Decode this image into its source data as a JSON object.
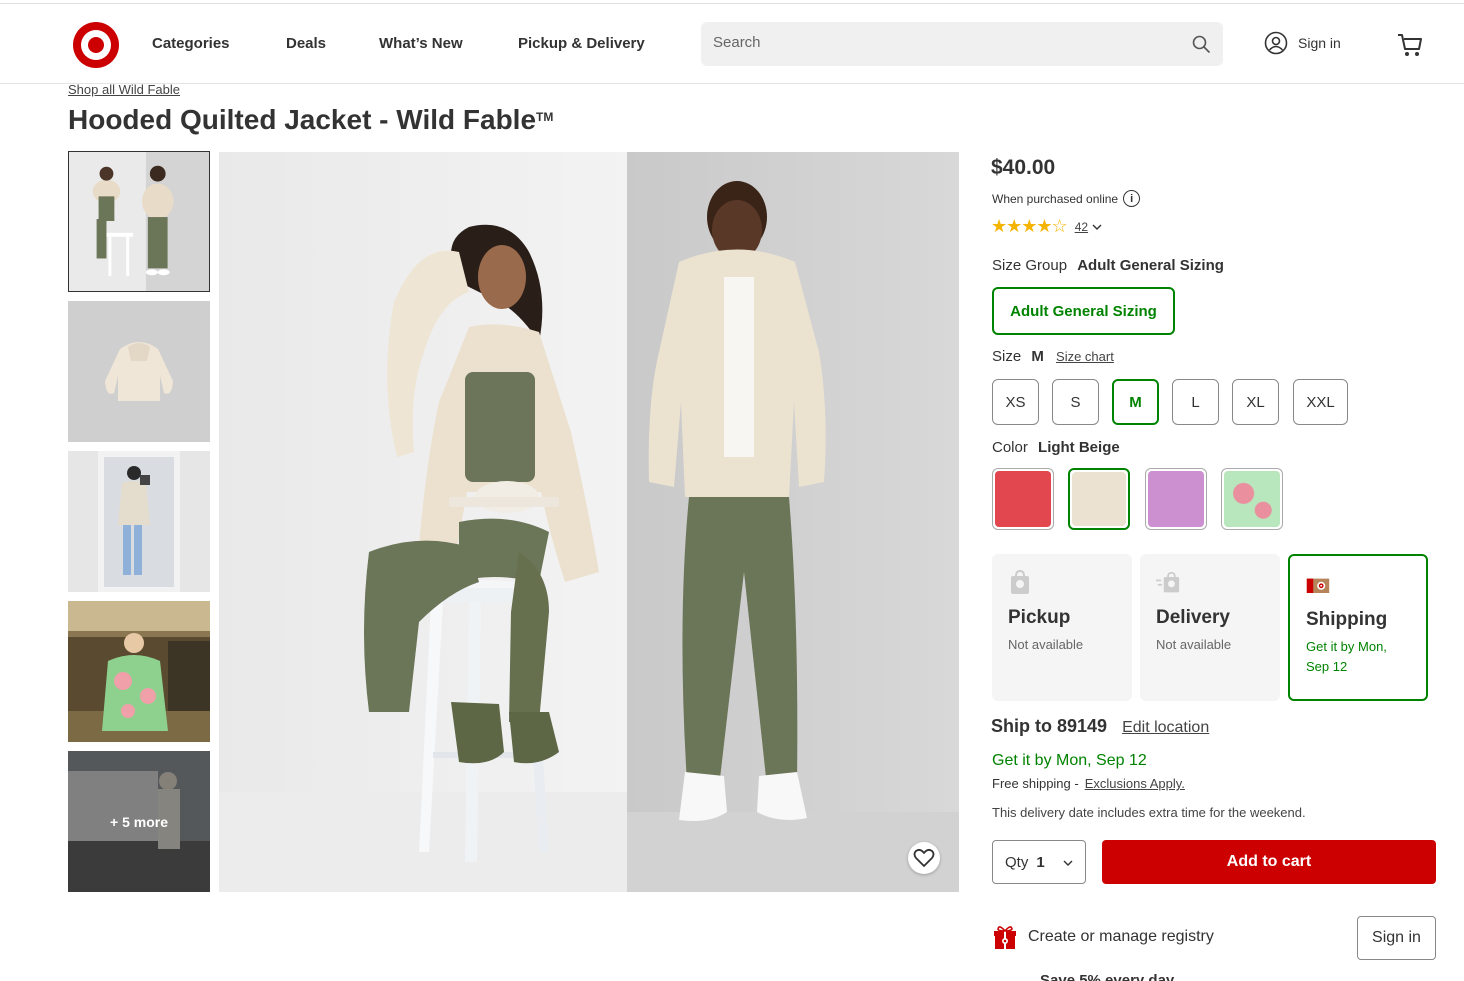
{
  "header": {
    "nav": [
      "Categories",
      "Deals",
      "What’s New",
      "Pickup & Delivery"
    ],
    "search_placeholder": "Search",
    "signin_label": "Sign in"
  },
  "breadcrumb": "Shop all Wild Fable",
  "product": {
    "title": "Hooded Quilted Jacket - Wild Fable",
    "trademark": "TM",
    "price": "$40.00",
    "price_note": "When purchased online",
    "rating_stars": "★★★★☆",
    "rating_value": 4.4,
    "rating_count": "42",
    "more_images": "+ 5 more"
  },
  "size_group": {
    "label": "Size Group",
    "value": "Adult General Sizing",
    "options": [
      "Adult General Sizing"
    ]
  },
  "size": {
    "label": "Size",
    "value": "M",
    "chart_link": "Size chart",
    "options": [
      "XS",
      "S",
      "M",
      "L",
      "XL",
      "XXL"
    ]
  },
  "color": {
    "label": "Color",
    "value": "Light Beige",
    "swatches": [
      {
        "name": "red",
        "color": "#e2464f"
      },
      {
        "name": "light-beige",
        "color": "#ece2d2"
      },
      {
        "name": "purple",
        "color": "#cc8fcf"
      },
      {
        "name": "green-floral",
        "color": "#b9e7bd"
      }
    ]
  },
  "fulfillment": [
    {
      "title": "Pickup",
      "sub": "Not available"
    },
    {
      "title": "Delivery",
      "sub": "Not available"
    },
    {
      "title": "Shipping",
      "sub": "Get it by Mon, Sep 12"
    }
  ],
  "shipping": {
    "ship_to": "Ship to 89149",
    "edit_location": "Edit location",
    "get_it": "Get it by Mon, Sep 12",
    "free_shipping": "Free shipping -",
    "exclusions": "Exclusions Apply.",
    "weekend_note": "This delivery date includes extra time for the weekend."
  },
  "purchase": {
    "qty_label": "Qty",
    "qty_value": "1",
    "add_to_cart": "Add to cart"
  },
  "registry": {
    "label": "Create or manage registry",
    "signin": "Sign in",
    "save_text": "Save 5% every day"
  },
  "colors": {
    "brand_red": "#cc0000",
    "accent_green": "#008300"
  }
}
